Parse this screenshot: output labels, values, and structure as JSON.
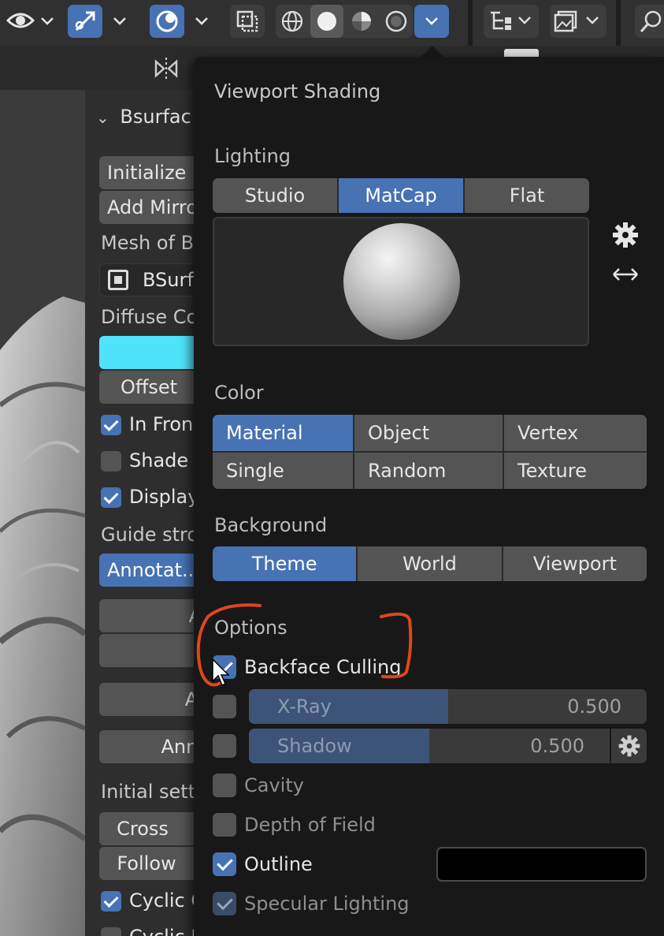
{
  "header": {
    "tools": [
      "visibility-icon",
      "gizmo-icon",
      "overlay-icon",
      "xray-toggle-icon",
      "wireframe-shading-icon",
      "solid-shading-icon",
      "material-shading-icon",
      "rendered-shading-icon"
    ],
    "right_icons": [
      "outliner-filter-icon",
      "image-icon",
      "search-icon"
    ]
  },
  "sidebar": {
    "panel_title": "Bsurfac",
    "initialize_label": "Initialize (",
    "add_mirror_label": "Add Mirro",
    "mesh_label": "Mesh of B",
    "mesh_value": "BSurf",
    "diffuse_label": "Diffuse Co",
    "diffuse_color": "#4fe3fb",
    "offset_label": "Offset",
    "in_front_label": "In Fron",
    "shade_label": "Shade",
    "display_label": "Display",
    "guide_label": "Guide stro",
    "annotation_label": "Annotat...",
    "btn_a_label": "A",
    "btn_add_label": "Ad",
    "btn_anno_label": "Anno",
    "initial_label": "Initial sett",
    "cross_label": "Cross",
    "follow_label": "Follow",
    "cyclic_label": "Cyclic C",
    "cyclic2_label": "Cyclic I"
  },
  "popover": {
    "title": "Viewport Shading",
    "lighting": {
      "label": "Lighting",
      "options": [
        "Studio",
        "MatCap",
        "Flat"
      ],
      "selected": "MatCap"
    },
    "color": {
      "label": "Color",
      "options": [
        "Material",
        "Object",
        "Vertex",
        "Single",
        "Random",
        "Texture"
      ],
      "selected": "Material"
    },
    "background": {
      "label": "Background",
      "options": [
        "Theme",
        "World",
        "Viewport"
      ],
      "selected": "Theme"
    },
    "options": {
      "label": "Options",
      "backface_culling": "Backface Culling",
      "xray_label": "X-Ray",
      "xray_value": "0.500",
      "xray_fraction": 0.5,
      "shadow_label": "Shadow",
      "shadow_value": "0.500",
      "shadow_fraction": 0.5,
      "cavity": "Cavity",
      "depth_of_field": "Depth of Field",
      "outline": "Outline",
      "outline_color": "#000000",
      "specular": "Specular Lighting"
    }
  },
  "colors": {
    "accent": "#4772b3",
    "annotation": "#e0461c"
  }
}
